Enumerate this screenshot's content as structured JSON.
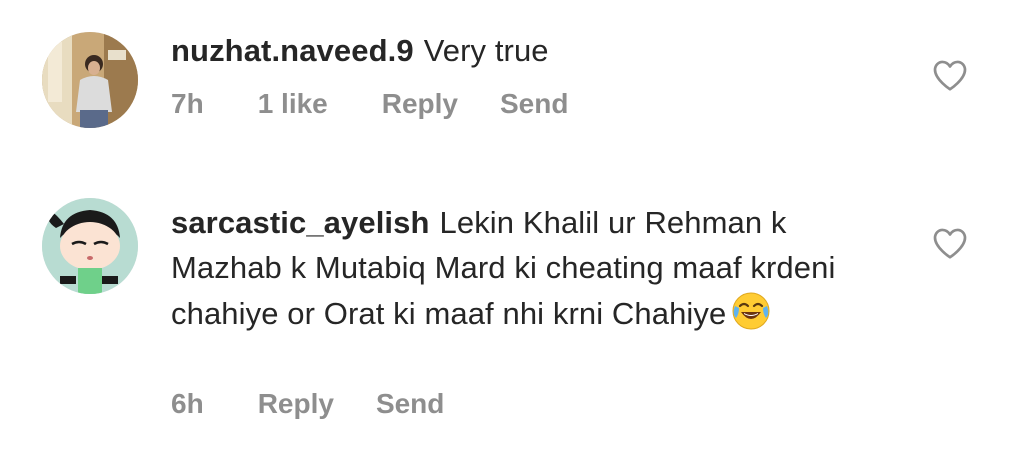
{
  "comments": [
    {
      "username": "nuzhat.naveed.9",
      "text": "Very true",
      "time": "7h",
      "likes": "1 like",
      "reply": "Reply",
      "send": "Send",
      "avatar_icon": "profile-photo-woman-mall"
    },
    {
      "username": "sarcastic_ayelish",
      "text": "Lekin Khalil ur Rehman k Mazhab k Mutabiq Mard ki cheating maaf krdeni chahiye or Orat ki maaf nhi krni Chahiye",
      "emoji": "face-with-tears-of-joy-emoji",
      "time": "6h",
      "reply": "Reply",
      "send": "Send",
      "avatar_icon": "cartoon-girl-avatar"
    }
  ],
  "colors": {
    "text": "#262626",
    "meta": "#8e8e8e",
    "heart_stroke": "#8e8e8e"
  }
}
